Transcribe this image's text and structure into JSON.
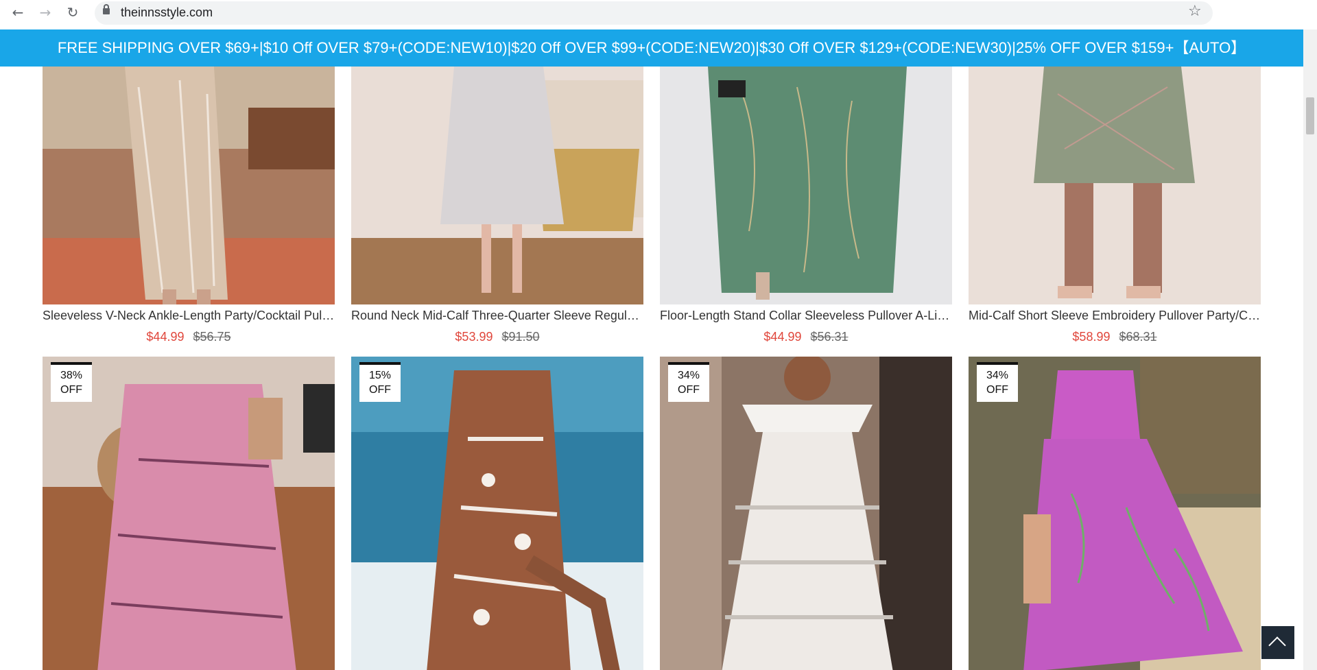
{
  "browser": {
    "url": "theinnsstyle.com",
    "back_icon": "←",
    "forward_icon": "→",
    "reload_icon": "↻",
    "star_icon": "☆"
  },
  "promo": {
    "text": "FREE SHIPPING OVER $69+|$10 Off OVER $79+(CODE:NEW10)|$20 Off OVER $99+(CODE:NEW20)|$30 Off OVER $129+(CODE:NEW30)|25% OFF OVER $159+【AUTO】",
    "color": "#19a6e8"
  },
  "products_row1": [
    {
      "title": "Sleeveless V-Neck Ankle-Length Party/Cocktail Pullov...",
      "price": "$44.99",
      "old_price": "$56.75"
    },
    {
      "title": "Round Neck Mid-Calf Three-Quarter Sleeve Regular ...",
      "price": "$53.99",
      "old_price": "$91.50"
    },
    {
      "title": "Floor-Length Stand Collar Sleeveless Pullover A-Line D...",
      "price": "$44.99",
      "old_price": "$56.31"
    },
    {
      "title": "Mid-Calf Short Sleeve Embroidery Pullover Party/Coc...",
      "price": "$58.99",
      "old_price": "$68.31"
    }
  ],
  "products_row2": [
    {
      "badge_pct": "38%",
      "badge_off": "OFF"
    },
    {
      "badge_pct": "15%",
      "badge_off": "OFF"
    },
    {
      "badge_pct": "34%",
      "badge_off": "OFF"
    },
    {
      "badge_pct": "34%",
      "badge_off": "OFF"
    }
  ],
  "colors": {
    "price": "#e0463b",
    "back_to_top": "#1f2a36"
  }
}
